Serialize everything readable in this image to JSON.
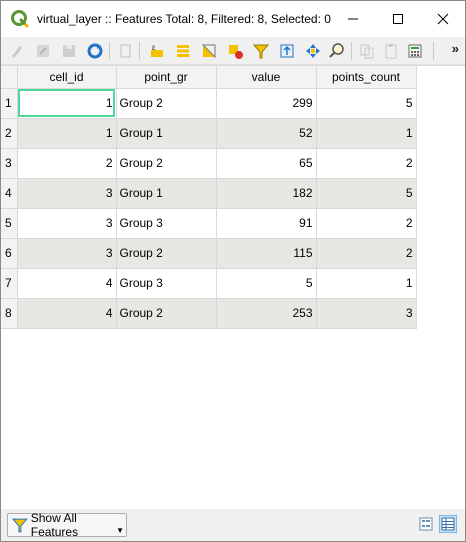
{
  "window": {
    "title": "virtual_layer :: Features Total: 8, Filtered: 8, Selected: 0"
  },
  "toolbar": {
    "more_label": "»"
  },
  "table": {
    "columns": [
      "cell_id",
      "point_gr",
      "value",
      "points_count"
    ],
    "rows": [
      {
        "index": "1",
        "cell_id": "1",
        "point_gr": "Group 2",
        "value": "299",
        "points_count": "5"
      },
      {
        "index": "2",
        "cell_id": "1",
        "point_gr": "Group 1",
        "value": "52",
        "points_count": "1"
      },
      {
        "index": "3",
        "cell_id": "2",
        "point_gr": "Group 2",
        "value": "65",
        "points_count": "2"
      },
      {
        "index": "4",
        "cell_id": "3",
        "point_gr": "Group 1",
        "value": "182",
        "points_count": "5"
      },
      {
        "index": "5",
        "cell_id": "3",
        "point_gr": "Group 3",
        "value": "91",
        "points_count": "2"
      },
      {
        "index": "6",
        "cell_id": "3",
        "point_gr": "Group 2",
        "value": "115",
        "points_count": "2"
      },
      {
        "index": "7",
        "cell_id": "4",
        "point_gr": "Group 3",
        "value": "5",
        "points_count": "1"
      },
      {
        "index": "8",
        "cell_id": "4",
        "point_gr": "Group 2",
        "value": "253",
        "points_count": "3"
      }
    ]
  },
  "statusbar": {
    "filter_label": "Show All Features"
  },
  "colors": {
    "selection_outline": "#4fd79a",
    "alt_row": "#e9e7e3"
  }
}
